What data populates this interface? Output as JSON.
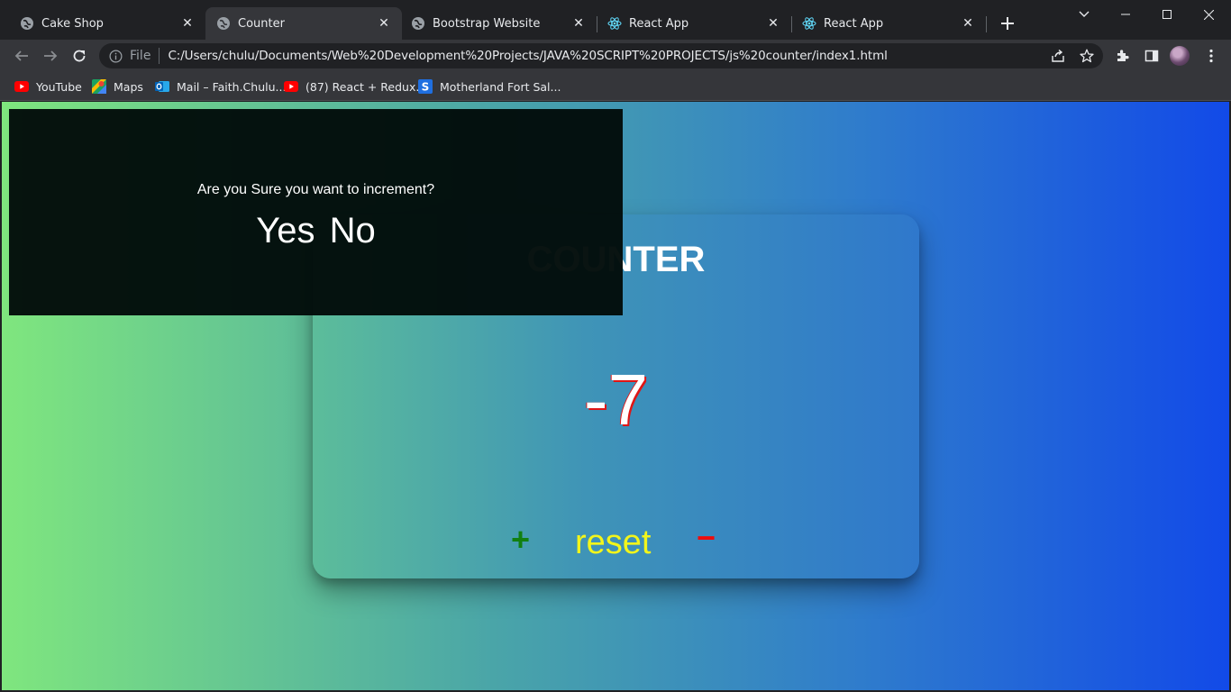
{
  "browser": {
    "tabs": [
      {
        "title": "Cake Shop",
        "icon": "globe-icon",
        "active": false
      },
      {
        "title": "Counter",
        "icon": "globe-icon",
        "active": true
      },
      {
        "title": "Bootstrap Website",
        "icon": "globe-icon",
        "active": false
      },
      {
        "title": "React App",
        "icon": "react-icon",
        "active": false
      },
      {
        "title": "React App",
        "icon": "react-icon",
        "active": false
      }
    ],
    "address": {
      "scheme_label": "File",
      "url": "C:/Users/chulu/Documents/Web%20Development%20Projects/JAVA%20SCRIPT%20PROJECTS/js%20counter/index1.html"
    },
    "bookmarks": [
      {
        "label": "YouTube",
        "icon": "youtube-icon"
      },
      {
        "label": "Maps",
        "icon": "maps-icon"
      },
      {
        "label": "Mail – Faith.Chulu...",
        "icon": "outlook-icon"
      },
      {
        "label": "(87) React + Redux...",
        "icon": "youtube-icon"
      },
      {
        "label": "Motherland Fort Sal...",
        "icon": "s-icon"
      }
    ]
  },
  "page": {
    "counter_title": "COUNTER",
    "count_value": "-7",
    "controls": {
      "increment": "+",
      "reset": "reset",
      "decrement": "−"
    },
    "modal": {
      "question": "Are you Sure you want to increment?",
      "yes": "Yes",
      "no": "No"
    }
  },
  "colors": {
    "gradient_start": "#7fe67e",
    "gradient_end": "#124ae8",
    "increment": "#118011",
    "reset": "#f2f51b",
    "decrement": "#ef0c0c",
    "modal_bg": "#020c0a"
  }
}
